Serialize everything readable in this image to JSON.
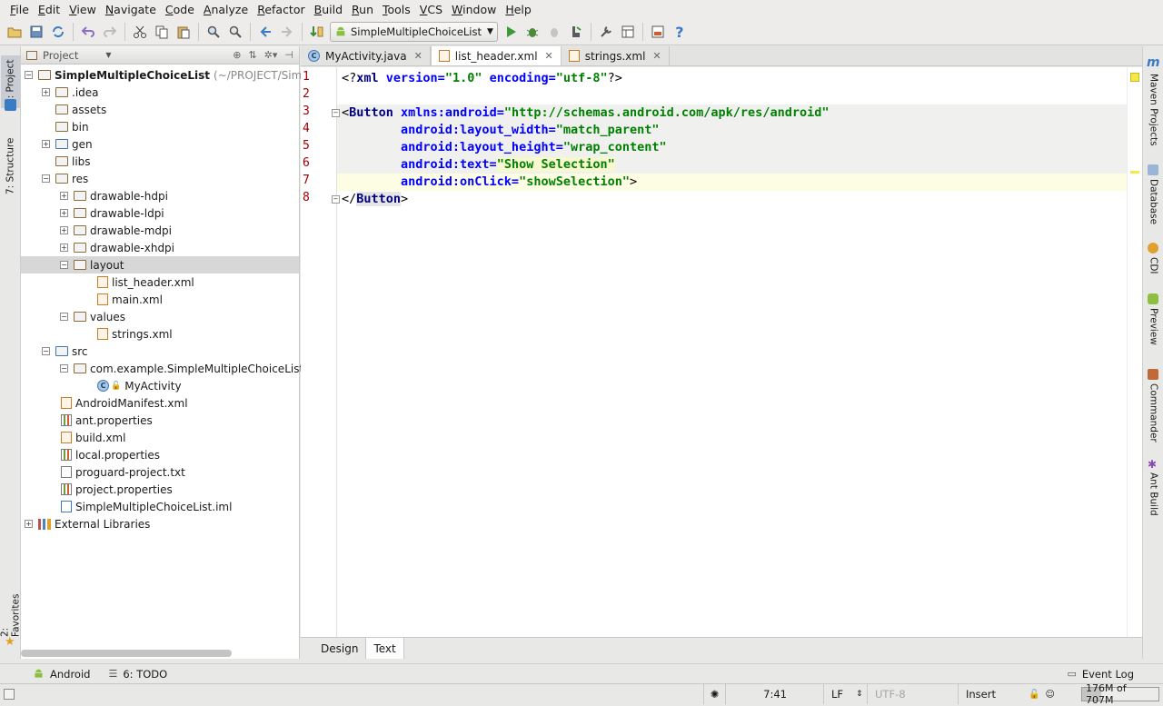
{
  "menu": [
    "File",
    "Edit",
    "View",
    "Navigate",
    "Code",
    "Analyze",
    "Refactor",
    "Build",
    "Run",
    "Tools",
    "VCS",
    "Window",
    "Help"
  ],
  "toolbar": {
    "run_config": "SimpleMultipleChoiceList",
    "help_label": "?"
  },
  "left_stripe": {
    "project_tab": "1: Project",
    "structure_tab": "7: Structure",
    "favorites_tab": "2: Favorites"
  },
  "right_stripe": [
    "Maven Projects",
    "Database",
    "CDI",
    "Preview",
    "Commander",
    "Ant Build"
  ],
  "project_panel": {
    "header": "Project",
    "root_label": "SimpleMultipleChoiceList",
    "root_path": "(~/PROJECT/SimpleM",
    "items": [
      {
        "label": ".idea"
      },
      {
        "label": "assets"
      },
      {
        "label": "bin"
      },
      {
        "label": "gen"
      },
      {
        "label": "libs"
      },
      {
        "label": "res"
      },
      {
        "label": "drawable-hdpi"
      },
      {
        "label": "drawable-ldpi"
      },
      {
        "label": "drawable-mdpi"
      },
      {
        "label": "drawable-xhdpi"
      },
      {
        "label": "layout"
      },
      {
        "label": "list_header.xml"
      },
      {
        "label": "main.xml"
      },
      {
        "label": "values"
      },
      {
        "label": "strings.xml"
      },
      {
        "label": "src"
      },
      {
        "label": "com.example.SimpleMultipleChoiceList"
      },
      {
        "label": "MyActivity"
      },
      {
        "label": "AndroidManifest.xml"
      },
      {
        "label": "ant.properties"
      },
      {
        "label": "build.xml"
      },
      {
        "label": "local.properties"
      },
      {
        "label": "proguard-project.txt"
      },
      {
        "label": "project.properties"
      },
      {
        "label": "SimpleMultipleChoiceList.iml"
      },
      {
        "label": "External Libraries"
      }
    ]
  },
  "editor_tabs": [
    {
      "label": "MyActivity.java",
      "active": false
    },
    {
      "label": "list_header.xml",
      "active": true
    },
    {
      "label": "strings.xml",
      "active": false
    }
  ],
  "code": {
    "line_numbers": [
      "1",
      "2",
      "3",
      "4",
      "5",
      "6",
      "7",
      "8"
    ],
    "l1": {
      "a": "<?",
      "b": "xml",
      "c": " version=",
      "d": "\"1.0\"",
      "e": " encoding=",
      "f": "\"utf-8\"",
      "g": "?>"
    },
    "l3": {
      "a": "<",
      "b": "Button",
      "c": " xmlns:android=",
      "d": "\"http://schemas.android.com/apk/res/android\""
    },
    "l4": {
      "a": "        android:layout_width=",
      "b": "\"match_parent\""
    },
    "l5": {
      "a": "        android:layout_height=",
      "b": "\"wrap_content\""
    },
    "l6": {
      "a": "        android:text=",
      "b": "\"Show Selection\""
    },
    "l7": {
      "a": "        android:onClick=",
      "b": "\"showSelection\"",
      "c": ">"
    },
    "l8": {
      "a": "</",
      "b": "Button",
      "c": ">"
    }
  },
  "bottom_tabs": [
    "Design",
    "Text"
  ],
  "tool_windows": {
    "android": "Android",
    "todo": "6: TODO",
    "event_log": "Event Log"
  },
  "status": {
    "position": "7:41",
    "line_sep": "LF",
    "encoding": "UTF-8",
    "mode": "Insert",
    "memory": "176M of 707M"
  }
}
